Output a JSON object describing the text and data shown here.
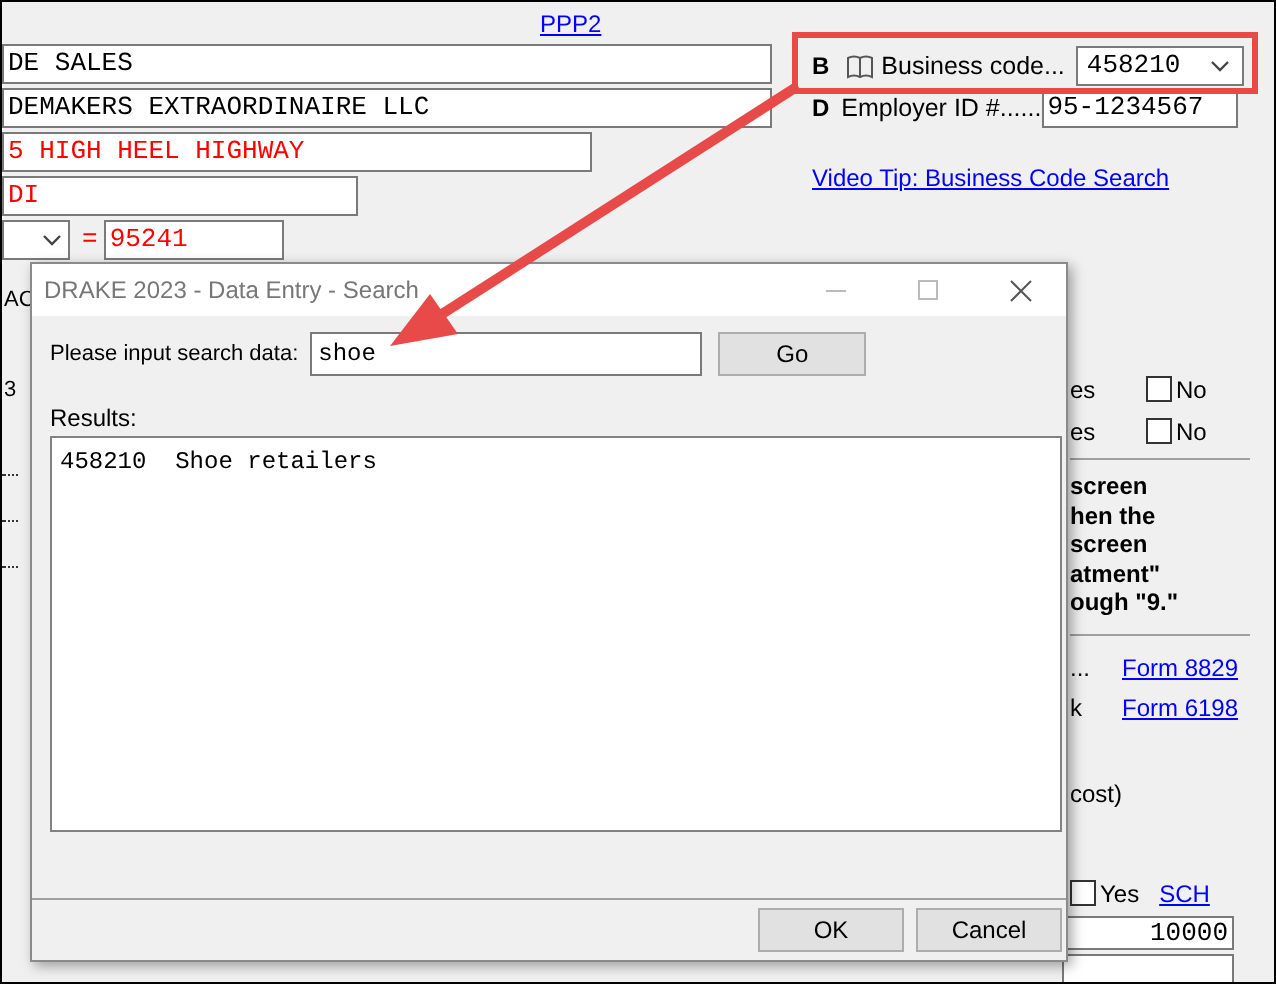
{
  "background_form": {
    "top_link": "PPP2",
    "name_fields": [
      {
        "value": "DE SALES",
        "color": "#000000"
      },
      {
        "value": "DEMAKERS EXTRAORDINAIRE LLC",
        "color": "#000000"
      },
      {
        "value": "5 HIGH HEEL HIGHWAY",
        "color": "#ff0000"
      },
      {
        "value": "DI",
        "color": "#ff0000"
      }
    ],
    "equals": "=",
    "zip": "95241",
    "business_code": {
      "letter": "B",
      "label": "Business code...",
      "value": "458210"
    },
    "employer_id": {
      "letter": "D",
      "label": "Employer ID #......",
      "value": "95-1234567"
    },
    "video_link": "Video Tip: Business Code Search",
    "left_fragments": [
      "AC",
      "3"
    ],
    "yes_no_rows": [
      {
        "label": "es",
        "option": "No",
        "checked": false
      },
      {
        "label": "es",
        "option": "No",
        "checked": false
      }
    ],
    "note_lines": [
      "screen",
      "hen the",
      "screen",
      "atment\"",
      "ough \"9.\""
    ],
    "form_links": [
      {
        "label": "...",
        "link": "Form 8829"
      },
      {
        "label": "k",
        "link": "Form 6198"
      }
    ],
    "cost_text": "cost)",
    "sch_row": {
      "option": "Yes",
      "checked": false,
      "link": "SCH"
    },
    "amounts": [
      "10000"
    ]
  },
  "dialog": {
    "title": "DRAKE 2023 - Data Entry - Search",
    "search_label": "Please input search data:",
    "search_value": "shoe",
    "go_button": "Go",
    "results_label": "Results:",
    "results": [
      {
        "code": "458210",
        "description": "Shoe retailers"
      }
    ],
    "buttons": [
      "OK",
      "Cancel"
    ]
  }
}
